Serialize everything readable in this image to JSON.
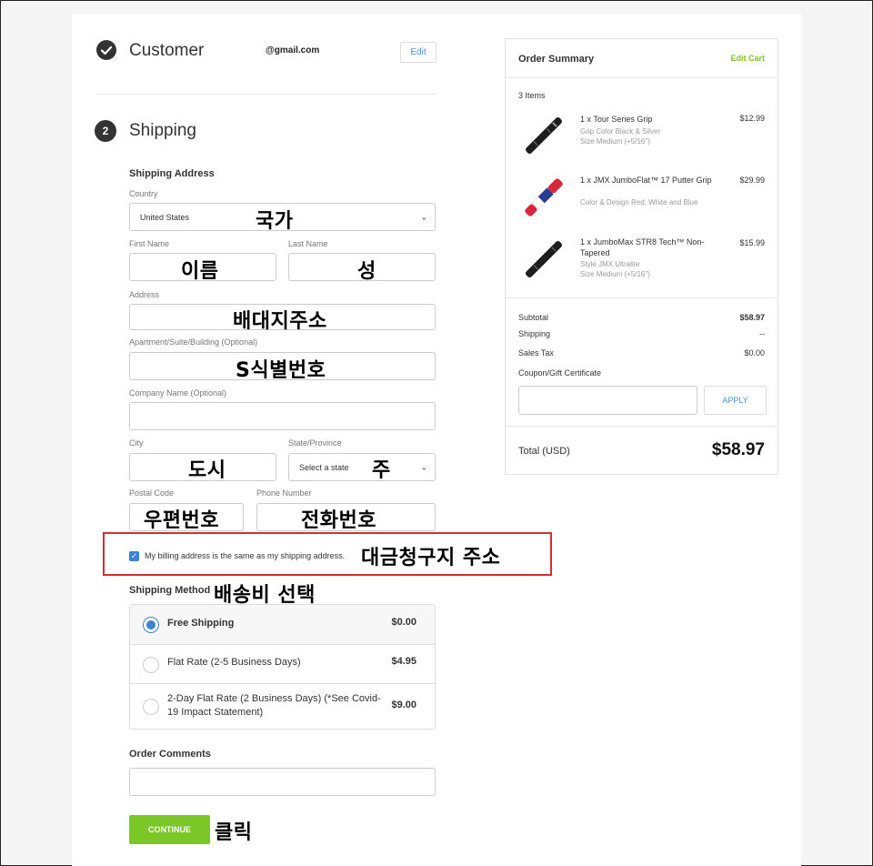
{
  "customer": {
    "title": "Customer",
    "email": "@gmail.com",
    "edit_label": "Edit"
  },
  "shipping": {
    "step_number": "2",
    "title": "Shipping",
    "address_heading": "Shipping Address",
    "country_label": "Country",
    "country_value": "United States",
    "first_name_label": "First Name",
    "last_name_label": "Last Name",
    "address_label": "Address",
    "apartment_label": "Apartment/Suite/Building (Optional)",
    "company_label": "Company Name (Optional)",
    "city_label": "City",
    "state_label": "State/Province",
    "state_placeholder": "Select a state",
    "postal_label": "Postal Code",
    "phone_label": "Phone Number",
    "billing_same_label": "My billing address is the same as my shipping address.",
    "method_heading": "Shipping Method",
    "methods": [
      {
        "label": "Free Shipping",
        "price": "$0.00",
        "selected": true
      },
      {
        "label": "Flat Rate (2-5 Business Days)",
        "price": "$4.95",
        "selected": false
      },
      {
        "label": "2-Day Flat Rate (2 Business Days) (*See Covid-19 Impact Statement)",
        "price": "$9.00",
        "selected": false
      }
    ],
    "comments_heading": "Order Comments",
    "continue_label": "CONTINUE"
  },
  "annotations": {
    "country": "국가",
    "first_name": "이름",
    "last_name": "성",
    "address": "배대지주소",
    "apartment": "S식별번호",
    "city": "도시",
    "state": "주",
    "postal": "우편번호",
    "phone": "전화번호",
    "billing": "대금청구지 주소",
    "method": "배송비 선택",
    "continue": "클릭"
  },
  "summary": {
    "title": "Order Summary",
    "edit_cart_label": "Edit Cart",
    "item_count": "3 Items",
    "items": [
      {
        "name": "1 x Tour Series Grip",
        "meta": [
          "Grip Color Black & Silver",
          "Size Medium (+5/16\")"
        ],
        "price": "$12.99",
        "image": "black-grip"
      },
      {
        "name": "1 x JMX JumboFlat™ 17 Putter Grip",
        "meta": [
          "Color & Design Red, White and Blue"
        ],
        "price": "$29.99",
        "image": "rwb-grip"
      },
      {
        "name": "1 x JumboMax STR8 Tech™ Non-Tapered",
        "meta": [
          "Style JMX Ultralite",
          "Size Medium (+5/16\")"
        ],
        "price": "$15.99",
        "image": "black-grip"
      }
    ],
    "subtotal_label": "Subtotal",
    "subtotal_value": "$58.97",
    "shipping_label": "Shipping",
    "shipping_value": "--",
    "tax_label": "Sales Tax",
    "tax_value": "$0.00",
    "coupon_label": "Coupon/Gift Certificate",
    "apply_label": "APPLY",
    "total_label": "Total (USD)",
    "total_value": "$58.97"
  },
  "colors": {
    "accent_green": "#7cc728",
    "accent_blue": "#3b82d6",
    "annotation_red": "#d32f2f"
  }
}
